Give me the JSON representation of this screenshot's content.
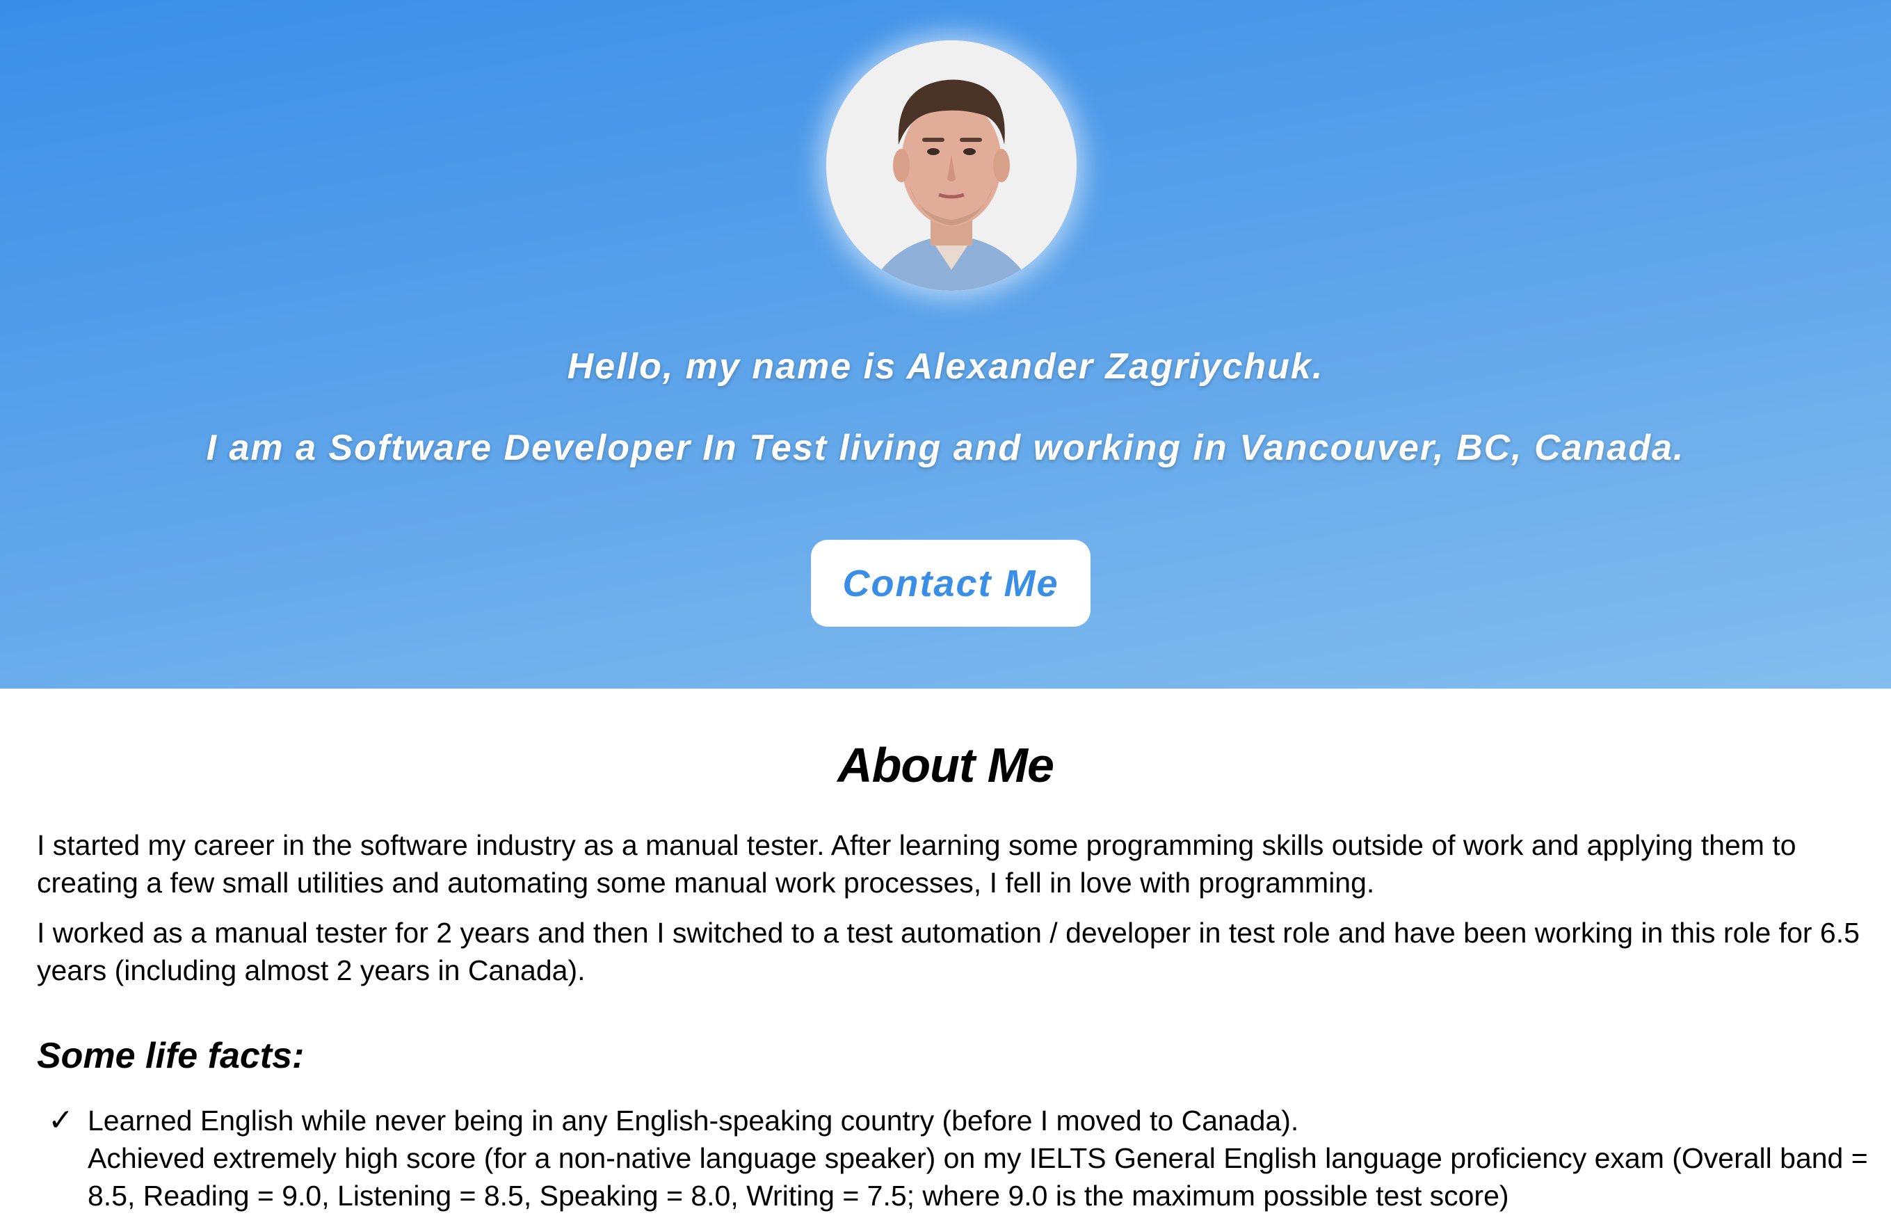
{
  "hero": {
    "avatar_alt": "Profile photo",
    "greeting": "Hello, my name is Alexander Zagriychuk.",
    "tagline": "I am a Software Developer In Test living and working in Vancouver, BC, Canada.",
    "contact_button": "Contact Me",
    "colors": {
      "gradient_start": "#3a8ee8",
      "gradient_end": "#83bdee",
      "button_text": "#3b8ee6"
    }
  },
  "about": {
    "title": "About Me",
    "paragraphs": [
      "I started my career in the software industry as a manual tester. After learning some programming skills outside of work and applying them to creating a few small utilities and automating some manual work processes, I fell in love with programming.",
      "I worked as a manual tester for 2 years and then I switched to a test automation / developer in test role and have been working in this role for 6.5 years (including almost 2 years in Canada)."
    ],
    "facts_title": "Some life facts:",
    "facts": [
      {
        "icon": "check-icon",
        "lines": [
          "Learned English while never being in any English-speaking country (before I moved to Canada).",
          "Achieved extremely high score (for a non-native language speaker) on my IELTS General English language proficiency exam (Overall band = 8.5, Reading = 9.0, Listening = 8.5, Speaking = 8.0, Writing = 7.5; where 9.0 is the maximum possible test score)"
        ]
      }
    ]
  }
}
